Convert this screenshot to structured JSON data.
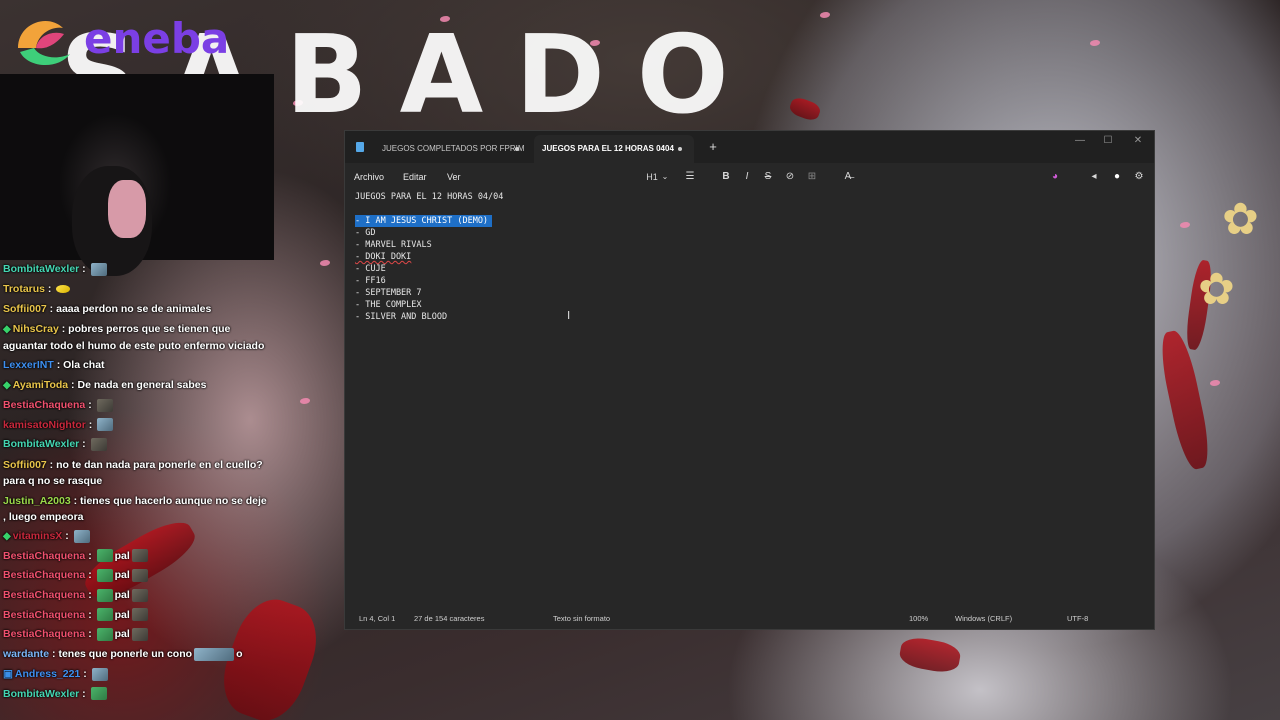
{
  "stream": {
    "sponsor": "eneba",
    "overlay_title": "SABADO"
  },
  "chat": [
    {
      "user": "BombitaWexler",
      "color": "#44d6b2",
      "msg": "",
      "emotes": [
        "emote"
      ]
    },
    {
      "user": "Trotarus",
      "color": "#e8c44a",
      "msg": "",
      "emotes": [
        "yellow"
      ]
    },
    {
      "user": "Soffii007",
      "color": "#e8c44a",
      "msg": "aaaa perdon no se de animales"
    },
    {
      "user": "NihsCray",
      "color": "#e8c44a",
      "badge": "diamond",
      "msg": "pobres perros que se tienen que aguantar todo el humo de este puto enfermo viciado"
    },
    {
      "user": "LexxerINT",
      "color": "#3d8ff0",
      "msg": "Ola chat"
    },
    {
      "user": "AyamiToda",
      "color": "#e8c44a",
      "badge": "diamond",
      "msg": "De nada en general sabes"
    },
    {
      "user": "BestiaChaquena",
      "color": "#f0506e",
      "msg": "",
      "emotes": [
        "sq"
      ]
    },
    {
      "user": "kamisatoNightor",
      "color": "#c8283c",
      "msg": "",
      "emotes": [
        "emote"
      ]
    },
    {
      "user": "BombitaWexler",
      "color": "#44d6b2",
      "msg": "",
      "emotes": [
        "sq"
      ]
    },
    {
      "user": "Soffii007",
      "color": "#e8c44a",
      "msg": "no te dan nada para ponerle en el cuello? para q no se rasque"
    },
    {
      "user": "Justin_A2003",
      "color": "#9bd94a",
      "msg": "tienes que hacerlo aunque no se deje , luego empeora"
    },
    {
      "user": "vitaminsX",
      "color": "#c8283c",
      "badge": "diamond",
      "msg": "",
      "emotes": [
        "emote"
      ]
    },
    {
      "user": "BestiaChaquena",
      "color": "#f0506e",
      "msg": "pal",
      "emotes": [
        "green"
      ]
    },
    {
      "user": "BestiaChaquena",
      "color": "#f0506e",
      "msg": "pal",
      "emotes": [
        "green"
      ]
    },
    {
      "user": "BestiaChaquena",
      "color": "#f0506e",
      "msg": "pal",
      "emotes": [
        "green"
      ]
    },
    {
      "user": "BestiaChaquena",
      "color": "#f0506e",
      "msg": "pal",
      "emotes": [
        "green"
      ]
    },
    {
      "user": "BestiaChaquena",
      "color": "#f0506e",
      "msg": "pal",
      "emotes": [
        "green"
      ]
    },
    {
      "user": "wardante",
      "color": "#7ab4f5",
      "msg": "tenes que ponerle un cono",
      "tail": "o"
    },
    {
      "user": "Andress_221",
      "color": "#3d8ff0",
      "badge": "sub",
      "msg": "",
      "emotes": [
        "emote"
      ]
    },
    {
      "user": "BombitaWexler",
      "color": "#44d6b2",
      "msg": "",
      "emotes": [
        "green"
      ]
    }
  ],
  "notepad": {
    "tabs": [
      {
        "label": "JUEGOS COMPLETADOS POR FPRIM",
        "active": false
      },
      {
        "label": "JUEGOS PARA EL 12 HORAS 0404",
        "active": true
      }
    ],
    "new_tab": "+",
    "window_controls": {
      "minimize": "—",
      "maximize": "☐",
      "close": "✕"
    },
    "menu": [
      "Archivo",
      "Editar",
      "Ver"
    ],
    "toolbar": {
      "heading": "H1",
      "heading_caret": "⌄",
      "list": "☰",
      "bold": "B",
      "italic": "I",
      "strike": "S",
      "link": "⊘",
      "table": "⊞",
      "format_clear": "A̶",
      "copilot": "◕",
      "share": "◂",
      "settings": "⚙"
    },
    "lines": [
      "JUEGOS PARA EL 12 HORAS 04/04",
      "",
      "- I AM JESUS CHRIST (DEMO)",
      "- GD",
      "- MARVEL RIVALS",
      "- DOKI DOKI",
      "- CUJE",
      "- FF16",
      "- SEPTEMBER 7",
      "- THE COMPLEX",
      "- SILVER AND BLOOD"
    ],
    "cursor_glyph": "I",
    "status": {
      "position": "Ln 4, Col 1",
      "chars": "27 de 154 caracteres",
      "format": "Texto sin formato",
      "zoom": "100%",
      "line_ending": "Windows (CRLF)",
      "encoding": "UTF-8"
    }
  }
}
